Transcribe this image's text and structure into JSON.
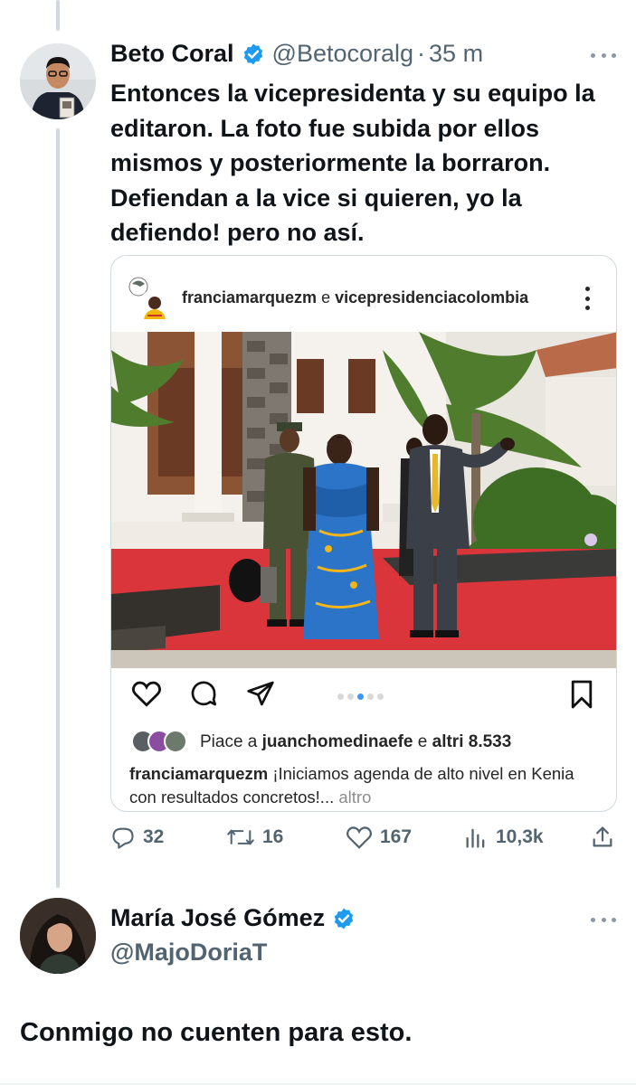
{
  "tweet": {
    "author_name": "Beto Coral",
    "handle": "@Betocoralg",
    "separator": "·",
    "time": "35 m",
    "text": "Entonces la vicepresidenta y su equipo la editaron. La foto fue subida por ellos mismos y posteriormente la borraron. Defiendan a la vice si quieren, yo la defiendo! pero no así.",
    "stats": {
      "replies": "32",
      "retweets": "16",
      "likes": "167",
      "views": "10,3k"
    }
  },
  "instagram_post": {
    "account_1": "franciamarquezm",
    "conjunction": " e ",
    "account_2": "vicepresidenciacolombia",
    "likes_prefix": "Piace a ",
    "likes_user": "juanchomedinaefe",
    "likes_mid": " e ",
    "likes_others": "altri 8.533",
    "caption_user": "franciamarquezm",
    "caption_text": " ¡Iniciamos agenda de alto nivel en Kenia con resultados concretos!...",
    "caption_more": " altro",
    "carousel_dots": 5,
    "carousel_active": 3
  },
  "reply": {
    "author_name": "María José Gómez",
    "handle": "@MajoDoriaT",
    "text": "Conmigo no cuenten para esto."
  },
  "colors": {
    "verified": "#1d9bf0",
    "secondary_text": "#536471",
    "thread_line": "#cfd9de",
    "carousel_active": "#3b98f0",
    "red_carpet": "#d9353b"
  },
  "icons": [
    "verified-badge-icon",
    "more-icon",
    "heart-icon",
    "comment-icon",
    "share-icon",
    "bookmark-icon",
    "reply-icon",
    "retweet-icon",
    "like-icon",
    "views-icon",
    "upload-icon"
  ]
}
